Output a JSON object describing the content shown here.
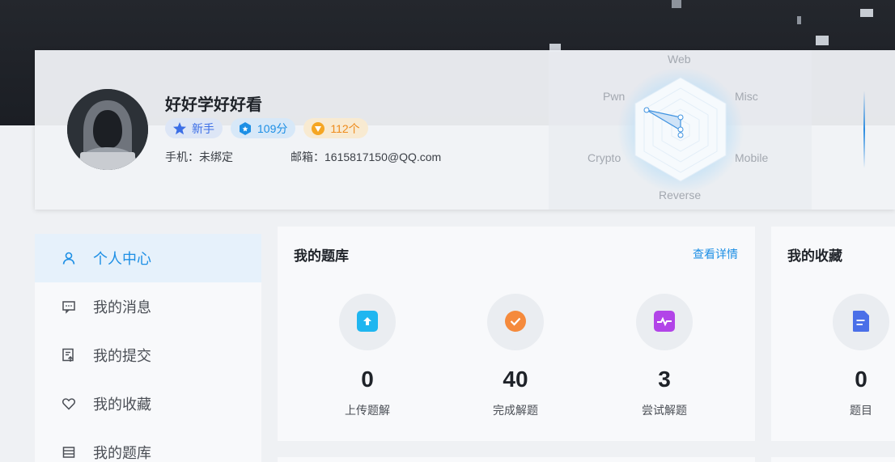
{
  "profile": {
    "username": "好好学好好看",
    "badges": {
      "rank": "新手",
      "score": "109分",
      "coins": "112个"
    },
    "phone": "手机：未绑定",
    "email": "邮箱：1615817150@QQ.com"
  },
  "radar": {
    "axes": [
      "Web",
      "Misc",
      "Mobile",
      "Reverse",
      "Crypto",
      "Pwn"
    ]
  },
  "sidebar": {
    "items": [
      {
        "label": "个人中心",
        "icon": "user-icon",
        "active": true
      },
      {
        "label": "我的消息",
        "icon": "message-icon",
        "active": false
      },
      {
        "label": "我的提交",
        "icon": "submit-icon",
        "active": false
      },
      {
        "label": "我的收藏",
        "icon": "heart-icon",
        "active": false
      },
      {
        "label": "我的题库",
        "icon": "library-icon",
        "active": false
      }
    ]
  },
  "tiku": {
    "title": "我的题库",
    "link": "查看详情",
    "stats": [
      {
        "value": "0",
        "label": "上传题解",
        "icon": "upload-icon",
        "color": "#1fb6f0"
      },
      {
        "value": "40",
        "label": "完成解题",
        "icon": "check-icon",
        "color": "#f58a3c"
      },
      {
        "value": "3",
        "label": "尝试解题",
        "icon": "pulse-icon",
        "color": "#b244e8"
      }
    ]
  },
  "favorites": {
    "title": "我的收藏",
    "stats": [
      {
        "value": "0",
        "label": "题目",
        "icon": "document-icon",
        "color": "#4a6fe8"
      }
    ]
  },
  "colors": {
    "accent": "#1d8fe5",
    "hero_dark": "#1b1e24",
    "coin": "#ee8b1c"
  }
}
